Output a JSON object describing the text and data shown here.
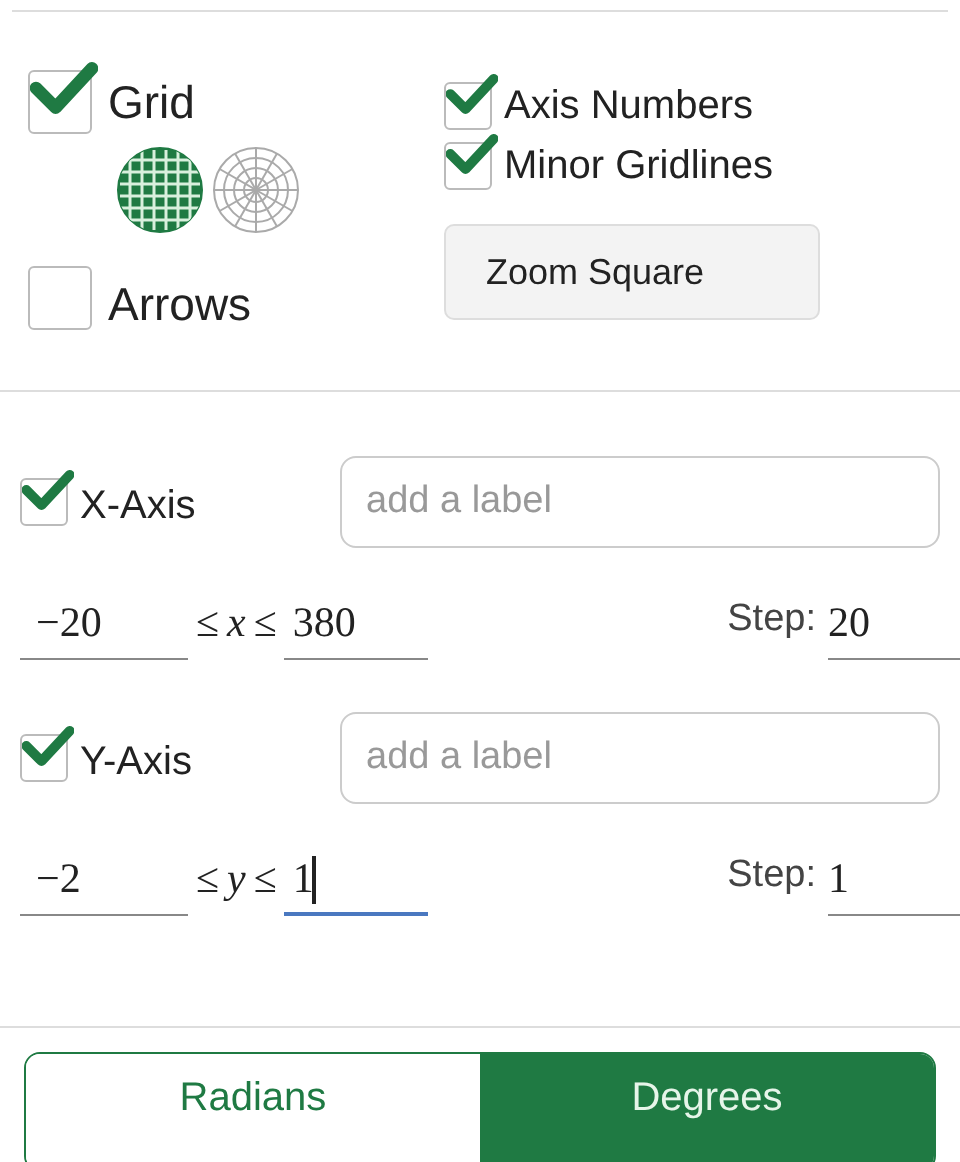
{
  "grid": {
    "label": "Grid",
    "checked": true,
    "types": [
      {
        "kind": "cartesian",
        "selected": true
      },
      {
        "kind": "polar",
        "selected": false
      }
    ]
  },
  "arrows": {
    "label": "Arrows",
    "checked": false
  },
  "axis_numbers": {
    "label": "Axis Numbers",
    "checked": true
  },
  "minor_gridlines": {
    "label": "Minor Gridlines",
    "checked": true
  },
  "zoom_button": "Zoom Square",
  "axes": [
    {
      "label": "X-Axis",
      "checked": true,
      "placeholder": "add a label",
      "min": "−20",
      "relation_1": "≤",
      "variable": "x",
      "relation_2": "≤",
      "max": "380",
      "max_focused": false,
      "step_label": "Step:",
      "step": "20"
    },
    {
      "label": "Y-Axis",
      "checked": true,
      "placeholder": "add a label",
      "min": "−2",
      "relation_1": "≤",
      "variable": "y",
      "relation_2": "≤",
      "max": "1",
      "max_focused": true,
      "step_label": "Step:",
      "step": "1"
    }
  ],
  "angle_modes": [
    {
      "label": "Radians",
      "selected": false
    },
    {
      "label": "Degrees",
      "selected": true
    }
  ]
}
